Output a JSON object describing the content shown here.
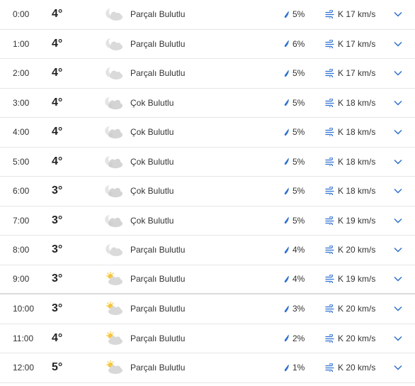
{
  "colors": {
    "accent": "#2f6fd0",
    "divider": "#e6e6e6",
    "cloud": "#dadada",
    "sun": "#f6c640"
  },
  "hours": [
    {
      "time": "0:00",
      "temp": "4°",
      "icon": "partly-cloudy-night-icon",
      "condition": "Parçalı Bulutlu",
      "precip": "5%",
      "wind": "K 17 km/s"
    },
    {
      "time": "1:00",
      "temp": "4°",
      "icon": "partly-cloudy-night-icon",
      "condition": "Parçalı Bulutlu",
      "precip": "6%",
      "wind": "K 17 km/s"
    },
    {
      "time": "2:00",
      "temp": "4°",
      "icon": "partly-cloudy-night-icon",
      "condition": "Parçalı Bulutlu",
      "precip": "5%",
      "wind": "K 17 km/s"
    },
    {
      "time": "3:00",
      "temp": "4°",
      "icon": "mostly-cloudy-night-icon",
      "condition": "Çok Bulutlu",
      "precip": "5%",
      "wind": "K 18 km/s"
    },
    {
      "time": "4:00",
      "temp": "4°",
      "icon": "mostly-cloudy-night-icon",
      "condition": "Çok Bulutlu",
      "precip": "5%",
      "wind": "K 18 km/s"
    },
    {
      "time": "5:00",
      "temp": "4°",
      "icon": "mostly-cloudy-night-icon",
      "condition": "Çok Bulutlu",
      "precip": "5%",
      "wind": "K 18 km/s"
    },
    {
      "time": "6:00",
      "temp": "3°",
      "icon": "mostly-cloudy-night-icon",
      "condition": "Çok Bulutlu",
      "precip": "5%",
      "wind": "K 18 km/s"
    },
    {
      "time": "7:00",
      "temp": "3°",
      "icon": "mostly-cloudy-night-icon",
      "condition": "Çok Bulutlu",
      "precip": "5%",
      "wind": "K 19 km/s"
    },
    {
      "time": "8:00",
      "temp": "3°",
      "icon": "partly-cloudy-night-icon",
      "condition": "Parçalı Bulutlu",
      "precip": "4%",
      "wind": "K 20 km/s"
    },
    {
      "time": "9:00",
      "temp": "3°",
      "icon": "partly-cloudy-day-icon",
      "condition": "Parçalı Bulutlu",
      "precip": "4%",
      "wind": "K 19 km/s"
    },
    {
      "time": "10:00",
      "temp": "3°",
      "icon": "partly-cloudy-day-icon",
      "condition": "Parçalı Bulutlu",
      "precip": "3%",
      "wind": "K 20 km/s"
    },
    {
      "time": "11:00",
      "temp": "4°",
      "icon": "partly-cloudy-day-icon",
      "condition": "Parçalı Bulutlu",
      "precip": "2%",
      "wind": "K 20 km/s"
    },
    {
      "time": "12:00",
      "temp": "5°",
      "icon": "partly-cloudy-day-icon",
      "condition": "Parçalı Bulutlu",
      "precip": "1%",
      "wind": "K 20 km/s"
    }
  ]
}
